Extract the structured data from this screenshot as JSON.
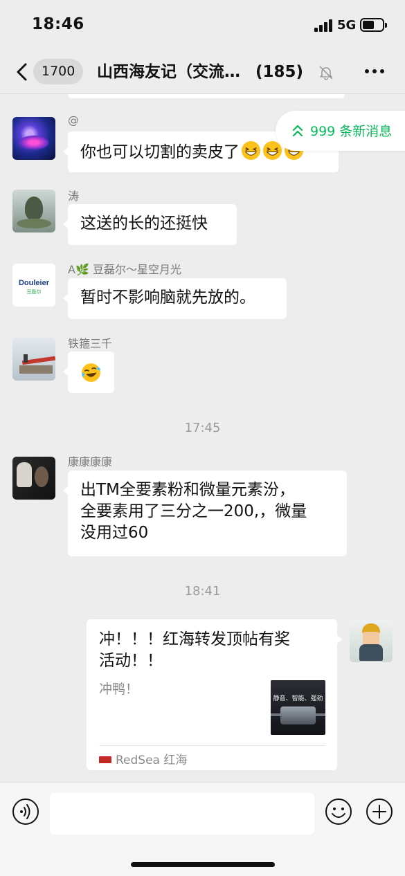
{
  "status_bar": {
    "time": "18:46",
    "network": "5G"
  },
  "nav": {
    "unread_count": "1700",
    "title": "山西海友记（交流…",
    "member_count": "(185)"
  },
  "new_messages_pill": "999 条新消息",
  "messages": [
    {
      "sender": "@",
      "text": "你也可以切割的卖皮了",
      "emoji_count": 3
    },
    {
      "sender": "涛",
      "text": "这送的长的还挺快"
    },
    {
      "sender": "A🌿 豆磊尔～星空月光",
      "text": "暂时不影响脑就先放的。",
      "avatar_brand": "Douleier",
      "avatar_brand_sub": "豆磊尔"
    },
    {
      "sender": "铁箍三千",
      "emoji": "crying-laughing-face"
    },
    {
      "sender": "康康康康",
      "text_lines": [
        "出TM全要素粉和微量元素汾，",
        "全要素用了三分之一200,，微量",
        "没用过60"
      ]
    }
  ],
  "time_dividers": [
    "17:45",
    "18:41"
  ],
  "outgoing_card": {
    "title_lines": [
      "冲！！！红海转发顶帖有奖",
      "活动！！"
    ],
    "description": "冲鸭！",
    "thumbnail_text": "静音、智能、强劲",
    "source": "RedSea 红海"
  },
  "colors": {
    "accent_green": "#07b95a",
    "background": "#ededed",
    "bubble": "#ffffff"
  }
}
